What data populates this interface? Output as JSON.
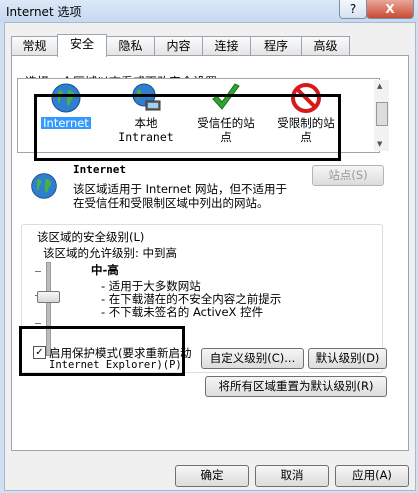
{
  "window": {
    "title": "Internet 选项",
    "help": "?",
    "close": "X"
  },
  "tabs": [
    "常规",
    "安全",
    "隐私",
    "内容",
    "连接",
    "程序",
    "高级"
  ],
  "active_tab": "安全",
  "zone_prompt": "选择一个区域以查看或更改安全设置。",
  "zones": [
    {
      "label": "Internet"
    },
    {
      "label": "本地",
      "label2": "Intranet"
    },
    {
      "label": "受信任的站",
      "label2": "点"
    },
    {
      "label": "受限制的站",
      "label2": "点"
    }
  ],
  "zone_info": {
    "name": "Internet",
    "desc1": "该区域适用于 Internet 网站，但不适用于",
    "desc2": "在受信任和受限制区域中列出的网站。",
    "sites_button": "站点(S)"
  },
  "security_level": {
    "group_title": "该区域的安全级别(L)",
    "allowed": "该区域的允许级别: 中到高",
    "level": "中-高",
    "bullets": [
      "- 适用于大多数网站",
      "- 在下载潜在的不安全内容之前提示",
      "- 不下载未签名的 ActiveX 控件"
    ]
  },
  "protected_mode": {
    "line1": "启用保护模式(要求重新启动",
    "line2": "Internet Explorer)(P)",
    "checked": true,
    "check_mark": "✓"
  },
  "buttons": {
    "custom_level": "自定义级别(C)...",
    "default_level": "默认级别(D)",
    "reset_all": "将所有区域重置为默认级别(R)",
    "ok": "确定",
    "cancel": "取消",
    "apply": "应用(A)"
  }
}
